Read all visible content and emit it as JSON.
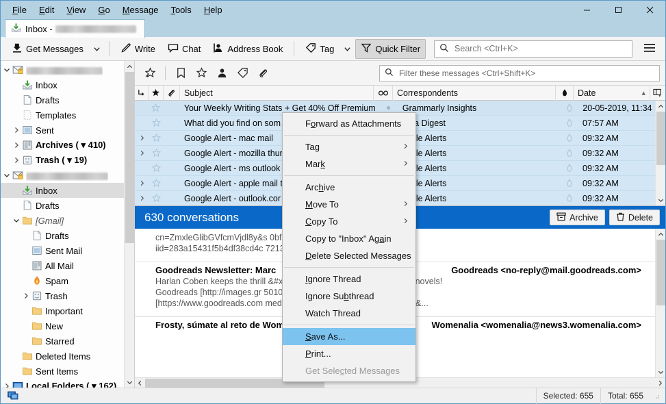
{
  "window": {
    "menus": [
      {
        "label": "File",
        "accel": "F"
      },
      {
        "label": "Edit",
        "accel": "E"
      },
      {
        "label": "View",
        "accel": "V"
      },
      {
        "label": "Go",
        "accel": "G"
      },
      {
        "label": "Message",
        "accel": "M"
      },
      {
        "label": "Tools",
        "accel": "T"
      },
      {
        "label": "Help",
        "accel": "H"
      }
    ],
    "minimize": "—",
    "maximize": "□",
    "close": "✕"
  },
  "tab": {
    "label": "Inbox - "
  },
  "toolbar": {
    "get_messages": "Get Messages",
    "write": "Write",
    "chat": "Chat",
    "address_book": "Address Book",
    "tag": "Tag",
    "quick_filter": "Quick Filter",
    "search_placeholder": "Search <Ctrl+K>",
    "search_value": ""
  },
  "quickfilter": {
    "filter_placeholder": "Filter these messages <Ctrl+Shift+K>",
    "filter_value": "",
    "buttons": [
      "unread-filter-icon",
      "starred-bookmark-icon",
      "star-filter-icon",
      "contact-filter-icon",
      "tag-filter-icon",
      "attachment-filter-icon"
    ]
  },
  "sidebar": {
    "accounts": [
      {
        "type": "account",
        "label": "",
        "redacted": true,
        "twisty": "down",
        "icon": "account-mail-icon",
        "indent": 0
      },
      {
        "type": "folder",
        "label": "Inbox",
        "icon": "inbox-icon",
        "indent": 1
      },
      {
        "type": "folder",
        "label": "Drafts",
        "icon": "drafts-icon",
        "indent": 1
      },
      {
        "type": "folder",
        "label": "Templates",
        "icon": "templates-icon",
        "indent": 1
      },
      {
        "type": "folder",
        "label": "Sent",
        "icon": "sent-icon",
        "indent": 1,
        "twisty": "right"
      },
      {
        "type": "folder",
        "label": "Archives ( ▾ 410)",
        "icon": "archives-icon",
        "indent": 1,
        "twisty": "right",
        "bold": true
      },
      {
        "type": "folder",
        "label": "Trash ( ▾ 19)",
        "icon": "trash-icon",
        "indent": 1,
        "twisty": "right",
        "bold": true
      },
      {
        "type": "account",
        "label": "",
        "redacted": true,
        "twisty": "down",
        "icon": "account-mail-icon",
        "indent": 0
      },
      {
        "type": "folder",
        "label": "Inbox",
        "icon": "inbox-icon",
        "indent": 1,
        "selected": true
      },
      {
        "type": "folder",
        "label": "Drafts",
        "icon": "drafts-icon",
        "indent": 1
      },
      {
        "type": "folder",
        "label": "[Gmail]",
        "icon": "folder-icon",
        "indent": 1,
        "twisty": "down",
        "italic": true
      },
      {
        "type": "folder",
        "label": "Drafts",
        "icon": "drafts-icon",
        "indent": 2
      },
      {
        "type": "folder",
        "label": "Sent Mail",
        "icon": "sent-icon",
        "indent": 2
      },
      {
        "type": "folder",
        "label": "All Mail",
        "icon": "archives-icon",
        "indent": 2
      },
      {
        "type": "folder",
        "label": "Spam",
        "icon": "spam-icon",
        "indent": 2
      },
      {
        "type": "folder",
        "label": "Trash",
        "icon": "trash-icon",
        "indent": 2,
        "twisty": "right"
      },
      {
        "type": "folder",
        "label": "Important",
        "icon": "folder-icon",
        "indent": 2
      },
      {
        "type": "folder",
        "label": "New",
        "icon": "folder-icon",
        "indent": 2
      },
      {
        "type": "folder",
        "label": "Starred",
        "icon": "folder-icon",
        "indent": 2
      },
      {
        "type": "folder",
        "label": "Deleted Items",
        "icon": "folder-icon",
        "indent": 1
      },
      {
        "type": "folder",
        "label": "Sent Items",
        "icon": "folder-icon",
        "indent": 1
      },
      {
        "type": "account",
        "label": "Local Folders ( ▾ 162)",
        "icon": "local-folders-icon",
        "indent": 0,
        "twisty": "right",
        "bold": true
      }
    ]
  },
  "threadpane": {
    "columns": {
      "thread": "thread-column-icon",
      "star": "star-column-icon",
      "attachment": "attachment-column-icon",
      "subject": "Subject",
      "unread": "unread-column-icon",
      "correspondents": "Correspondents",
      "junk": "junk-column-icon",
      "date": "Date",
      "sort_indicator": "▴",
      "picker": "column-picker-icon"
    },
    "rows": [
      {
        "subject": "Your Weekly Writing Stats + Get 40% Off Premium",
        "correspondent": "Grammarly Insights",
        "date": "20-05-2019, 11:34 ...",
        "selected": true,
        "unread_dot": true,
        "thread": false
      },
      {
        "subject": "What did you find on som",
        "correspondent": "uora Digest",
        "date": "07:57 AM",
        "thread": false
      },
      {
        "subject": "Google Alert - mac mail",
        "correspondent": "oogle Alerts",
        "date": "09:32 AM",
        "thread": true
      },
      {
        "subject": "Google Alert - mozilla thur",
        "correspondent": "oogle Alerts",
        "date": "09:32 AM",
        "thread": true
      },
      {
        "subject": "Google Alert - ms outlook",
        "correspondent": "oogle Alerts",
        "date": "09:32 AM",
        "thread": false
      },
      {
        "subject": "Google Alert - apple mail t",
        "correspondent": "oogle Alerts",
        "date": "09:32 AM",
        "thread": true
      },
      {
        "subject": "Google Alert - outlook.cor",
        "correspondent": "oogle Alerts",
        "date": "09:32 AM",
        "thread": true
      }
    ]
  },
  "preview": {
    "banner_title": "630 conversations",
    "archive_label": "Archive",
    "delete_label": "Delete",
    "messages": [
      {
        "subject": "",
        "from": "",
        "lines": [
          "cn=ZmxleGlibGVfcmVjdl8y&s                                     0bfa38f2460d78558&",
          "iid=283a15431f5b4df38cd4c                                   721319937&nid=244+26&usbid=9"
        ]
      },
      {
        "subject": "Goodreads Newsletter: Marc",
        "from": "Goodreads <no-reply@mail.goodreads.com>",
        "lines": [
          "Harlan Coben keeps the thrill                        &#x27;s most anticipated sci-fi and YA novels!",
          "Goodreads [http://images.gr                          501097225_goodreads_misc.png]",
          "[https://www.goodreads.com                          medium=email&utm_source=newsletter&..."
        ]
      },
      {
        "subject": "Frosty, súmate al reto de Womenalia Health Project",
        "from": "Womenalia <womenalia@news3.womenalia.com>",
        "lines": []
      }
    ]
  },
  "contextmenu": {
    "items": [
      {
        "label": "Forward as Attachments",
        "accel_index": 1,
        "type": "item"
      },
      {
        "type": "separator"
      },
      {
        "label": "Tag",
        "accel_index": 2,
        "type": "item",
        "submenu": true
      },
      {
        "label": "Mark",
        "accel_index": 3,
        "type": "item",
        "submenu": true
      },
      {
        "type": "separator"
      },
      {
        "label": "Archive",
        "accel_index": 3,
        "type": "item"
      },
      {
        "label": "Move To",
        "accel_index": 0,
        "type": "item",
        "submenu": true
      },
      {
        "label": "Copy To",
        "accel_index": 0,
        "type": "item",
        "submenu": true
      },
      {
        "label": "Copy to \"Inbox\" Again",
        "accel_index": 18,
        "type": "item"
      },
      {
        "label": "Delete Selected Messages",
        "accel_index": 0,
        "type": "item"
      },
      {
        "type": "separator"
      },
      {
        "label": "Ignore Thread",
        "accel_index": 0,
        "type": "item"
      },
      {
        "label": "Ignore Subthread",
        "accel_index": 9,
        "type": "item"
      },
      {
        "label": "Watch Thread",
        "accel_index": -1,
        "type": "item"
      },
      {
        "type": "separator"
      },
      {
        "label": "Save As...",
        "accel_index": 0,
        "type": "item",
        "highlighted": true
      },
      {
        "label": "Print...",
        "accel_index": 0,
        "type": "item"
      },
      {
        "label": "Get Selected Messages",
        "accel_index": 8,
        "type": "item",
        "disabled": true
      }
    ]
  },
  "statusbar": {
    "selected": "Selected: 655",
    "total": "Total: 655"
  },
  "colors": {
    "titlebar": "#b5d2e3",
    "banner_blue": "#0a69c8",
    "row_blue": "#d2e6f5",
    "menu_highlight": "#7cc3ef"
  }
}
